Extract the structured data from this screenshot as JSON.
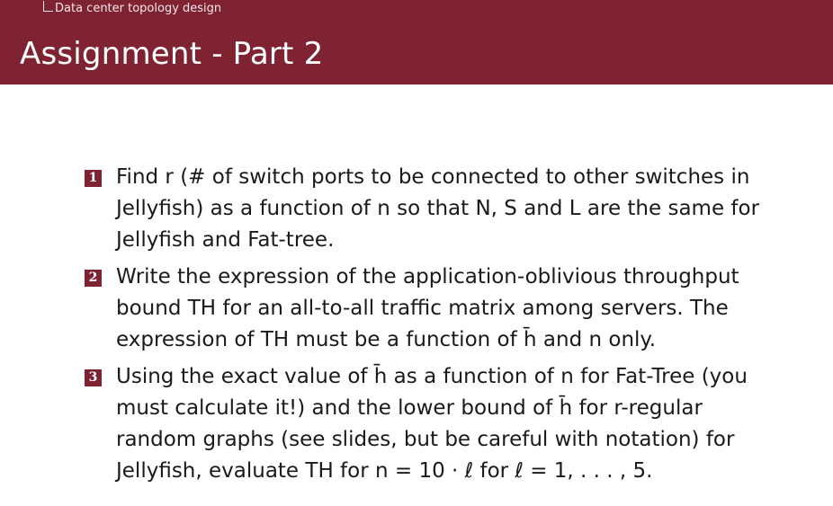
{
  "header": {
    "breadcrumb": "Data center topology design",
    "title": "Assignment - Part 2",
    "colors": {
      "header_background": "#7f2333",
      "header_text": "#ffffff"
    }
  },
  "items": [
    {
      "marker": "1",
      "text": "Find r (# of switch ports to be connected to other switches in Jellyfish) as a function of n so that N, S and L are the same for Jellyfish and Fat-tree."
    },
    {
      "marker": "2",
      "text": "Write the expression of the application-oblivious throughput bound TH for an all-to-all traffic matrix among servers. The expression of TH must be a function of h̄ and n only."
    },
    {
      "marker": "3",
      "text": "Using the exact value of h̄ as a function of n for Fat-Tree (you must calculate it!) and the lower bound of h̄ for r-regular random graphs (see slides, but be careful with notation) for Jellyfish, evaluate TH for n = 10 · ℓ for ℓ = 1, . . . , 5."
    }
  ]
}
